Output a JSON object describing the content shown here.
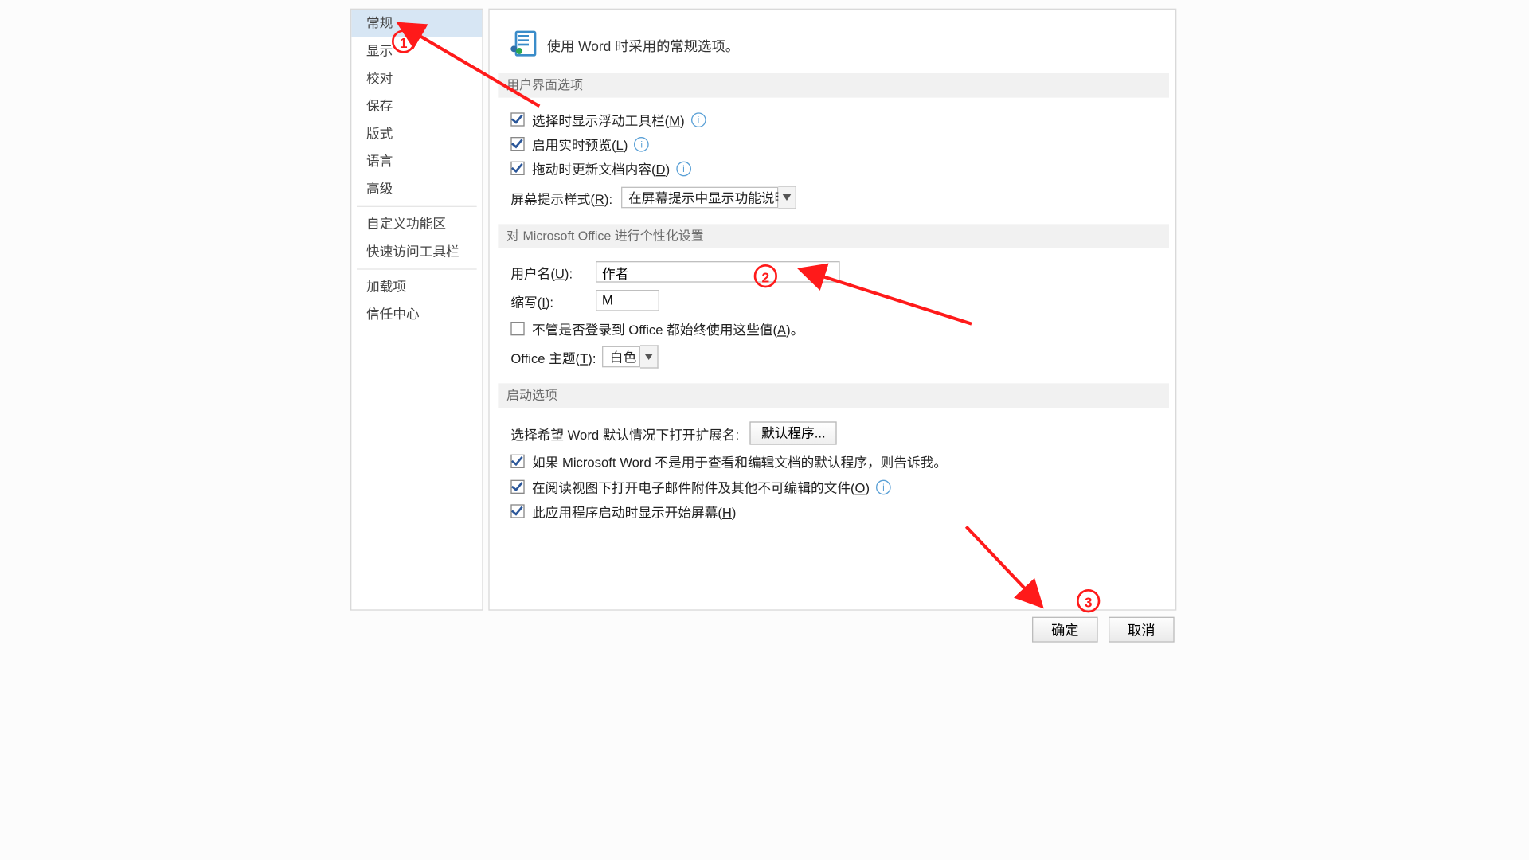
{
  "sidebar": {
    "items": [
      {
        "label": "常规"
      },
      {
        "label": "显示"
      },
      {
        "label": "校对"
      },
      {
        "label": "保存"
      },
      {
        "label": "版式"
      },
      {
        "label": "语言"
      },
      {
        "label": "高级"
      },
      {
        "label": "自定义功能区"
      },
      {
        "label": "快速访问工具栏"
      },
      {
        "label": "加载项"
      },
      {
        "label": "信任中心"
      }
    ]
  },
  "header": {
    "title": "使用 Word 时采用的常规选项。"
  },
  "sections": {
    "ui": {
      "title": "用户界面选项"
    },
    "personal": {
      "title": "对 Microsoft Office 进行个性化设置"
    },
    "startup": {
      "title": "启动选项"
    }
  },
  "ui_opts": {
    "chk_minitoolbar_pre": "选择时显示浮动工具栏(",
    "chk_minitoolbar_key": "M",
    "chk_minitoolbar_post": ")",
    "chk_livepreview_pre": "启用实时预览(",
    "chk_livepreview_key": "L",
    "chk_livepreview_post": ")",
    "chk_dragupdate_pre": "拖动时更新文档内容(",
    "chk_dragupdate_key": "D",
    "chk_dragupdate_post": ")",
    "tip_label_pre": "屏幕提示样式(",
    "tip_label_key": "R",
    "tip_label_post": "):",
    "tip_value": "在屏幕提示中显示功能说明"
  },
  "personal": {
    "username_label_pre": "用户名(",
    "username_label_key": "U",
    "username_label_post": "):",
    "username_value": "作者",
    "initials_label_pre": "缩写(",
    "initials_label_key": "I",
    "initials_label_post": "):",
    "initials_value": "M",
    "always_use_pre": "不管是否登录到 Office 都始终使用这些值(",
    "always_use_key": "A",
    "always_use_post": ")。",
    "theme_label_pre": "Office 主题(",
    "theme_label_key": "T",
    "theme_label_post": "):",
    "theme_value": "白色"
  },
  "startup": {
    "ext_label": "选择希望 Word 默认情况下打开扩展名:",
    "ext_button": "默认程序...",
    "chk_notdefault": "如果 Microsoft Word 不是用于查看和编辑文档的默认程序，则告诉我。",
    "chk_readingview_pre": "在阅读视图下打开电子邮件附件及其他不可编辑的文件(",
    "chk_readingview_key": "O",
    "chk_readingview_post": ")",
    "chk_startscreen_pre": "此应用程序启动时显示开始屏幕(",
    "chk_startscreen_key": "H",
    "chk_startscreen_post": ")"
  },
  "footer": {
    "ok": "确定",
    "cancel": "取消"
  },
  "annotations": {
    "n1": "1",
    "n2": "2",
    "n3": "3"
  }
}
